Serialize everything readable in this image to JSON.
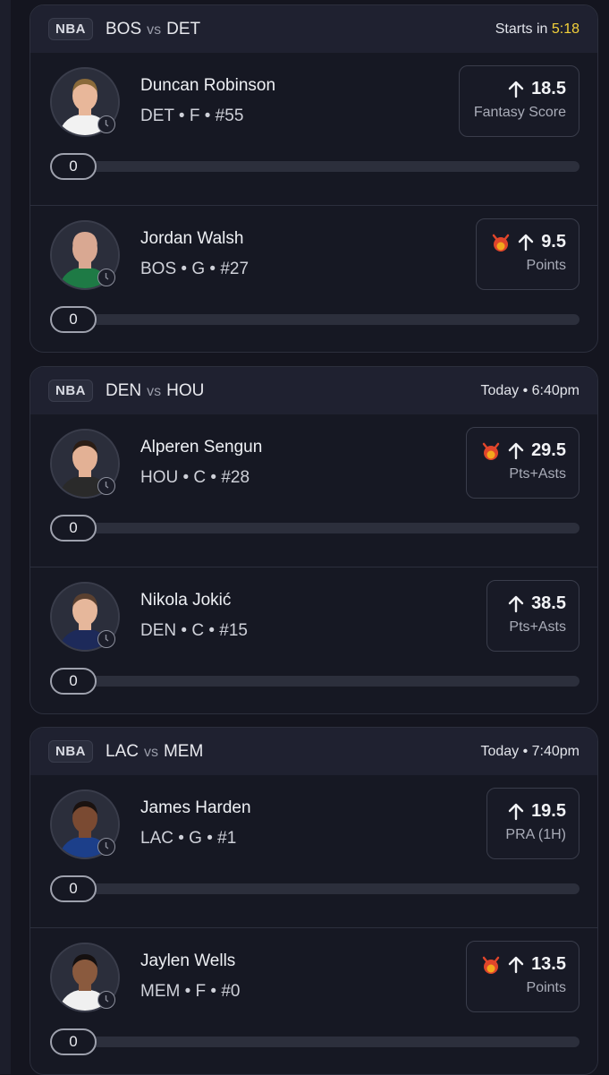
{
  "games": [
    {
      "league": "NBA",
      "team_a": "BOS",
      "vs": "vs",
      "team_b": "DET",
      "time_prefix": "Starts in ",
      "time_accent": "5:18",
      "players": [
        {
          "name": "Duncan Robinson",
          "meta": "DET • F • #55",
          "line": "18.5",
          "stat": "Fantasy Score",
          "devil": false,
          "progress_value": "0",
          "progress_fraction": 0,
          "jersey_color": "#f2f2f2",
          "skin": "#e8b79a",
          "hair": "#8a6a3a"
        },
        {
          "name": "Jordan Walsh",
          "meta": "BOS • G • #27",
          "line": "9.5",
          "stat": "Points",
          "devil": true,
          "progress_value": "0",
          "progress_fraction": 0,
          "jersey_color": "#1e7a45",
          "skin": "#d9a892",
          "hair": "#d9a892"
        }
      ]
    },
    {
      "league": "NBA",
      "team_a": "DEN",
      "vs": "vs",
      "team_b": "HOU",
      "time_prefix": "Today • 6:40pm",
      "time_accent": "",
      "players": [
        {
          "name": "Alperen Sengun",
          "meta": "HOU • C • #28",
          "line": "29.5",
          "stat": "Pts+Asts",
          "devil": true,
          "progress_value": "0",
          "progress_fraction": 0,
          "jersey_color": "#2a2a2a",
          "skin": "#e3b195",
          "hair": "#2b1d15"
        },
        {
          "name": "Nikola Jokić",
          "meta": "DEN • C • #15",
          "line": "38.5",
          "stat": "Pts+Asts",
          "devil": false,
          "progress_value": "0",
          "progress_fraction": 0,
          "jersey_color": "#1d2a5a",
          "skin": "#e6b79b",
          "hair": "#5a4030"
        }
      ]
    },
    {
      "league": "NBA",
      "team_a": "LAC",
      "vs": "vs",
      "team_b": "MEM",
      "time_prefix": "Today • 7:40pm",
      "time_accent": "",
      "players": [
        {
          "name": "James Harden",
          "meta": "LAC • G • #1",
          "line": "19.5",
          "stat": "PRA (1H)",
          "devil": false,
          "progress_value": "0",
          "progress_fraction": 0,
          "jersey_color": "#1c3f8a",
          "skin": "#7a4a32",
          "hair": "#1a1210"
        },
        {
          "name": "Jaylen Wells",
          "meta": "MEM • F • #0",
          "line": "13.5",
          "stat": "Points",
          "devil": true,
          "progress_value": "0",
          "progress_fraction": 0,
          "jersey_color": "#f0f0f0",
          "skin": "#8a5a3e",
          "hair": "#151010"
        }
      ]
    }
  ],
  "colors": {
    "accent": "#f4d23a",
    "devil": "#e0452b"
  }
}
